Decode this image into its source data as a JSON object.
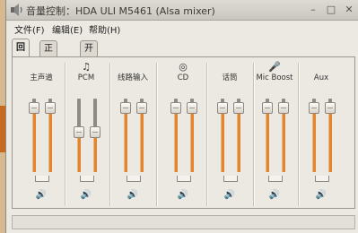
{
  "window": {
    "title": "音量控制：HDA ULI M5461 (Alsa mixer)"
  },
  "titlebar": {
    "minimize_label": "–",
    "maximize_label": "□",
    "close_label": "✕"
  },
  "menu": [
    "文件(F)",
    "编辑(E)",
    "帮助(H)"
  ],
  "tabs": [
    {
      "label": "回放",
      "active": true
    },
    {
      "label": "正在录音",
      "active": false
    },
    {
      "label": "开关",
      "active": false
    }
  ],
  "channels": [
    {
      "label": "主声道",
      "icon": "",
      "left_level": 0.95,
      "right_level": 0.95,
      "stereo": true
    },
    {
      "label": "PCM",
      "icon": "♫",
      "left_level": 0.62,
      "right_level": 0.62,
      "stereo": true
    },
    {
      "label": "线路输入",
      "icon": "",
      "left_level": 0.95,
      "right_level": 0.95,
      "stereo": true
    },
    {
      "label": "CD",
      "icon": "◎",
      "left_level": 0.95,
      "right_level": 0.95,
      "stereo": true
    },
    {
      "label": "话筒",
      "icon": "",
      "left_level": 0.95,
      "right_level": 0.95,
      "stereo": true
    },
    {
      "label": "Mic Boost",
      "icon": "🎤",
      "left_level": 0.95,
      "right_level": 0.95,
      "stereo": true
    },
    {
      "label": "Aux",
      "icon": "",
      "left_level": 0.95,
      "right_level": 0.95,
      "stereo": true
    }
  ],
  "speaker_icon": "🔊"
}
